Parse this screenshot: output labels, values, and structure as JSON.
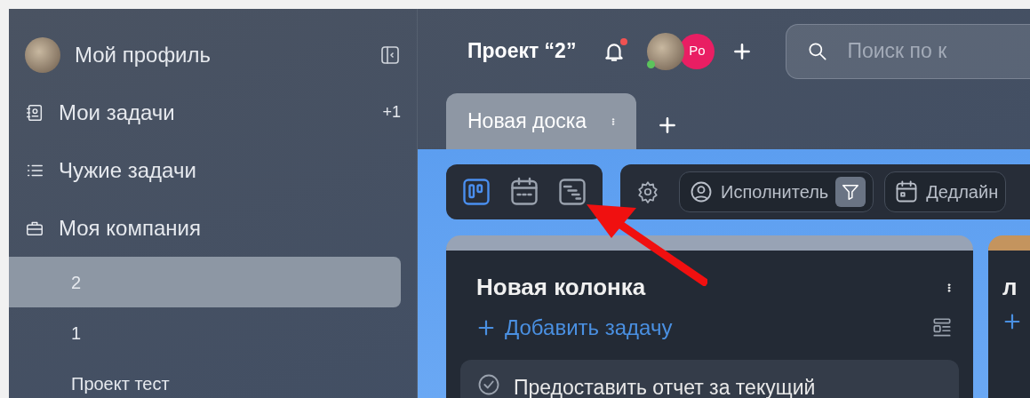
{
  "sidebar": {
    "profile": {
      "name": "Мой профиль"
    },
    "items": [
      {
        "kind": "my-tasks",
        "label": "Мои задачи",
        "badge": "+1"
      },
      {
        "kind": "others-tasks",
        "label": "Чужие задачи"
      },
      {
        "kind": "company",
        "label": "Моя компания"
      }
    ],
    "projects": [
      {
        "label": "2",
        "selected": true
      },
      {
        "label": "1",
        "selected": false
      },
      {
        "label": "Проект тест",
        "selected": false
      }
    ]
  },
  "header": {
    "title": "Проект “2”",
    "notification_dot": true,
    "avatars": [
      {
        "kind": "photo",
        "online": true
      },
      {
        "kind": "initials",
        "initials": "Po",
        "color": "#e91e63"
      }
    ],
    "search": {
      "placeholder": "Поиск по к"
    }
  },
  "tabs": [
    {
      "label": "Новая доска",
      "selected": true
    }
  ],
  "view_modes": [
    {
      "kind": "board",
      "selected": true
    },
    {
      "kind": "calendar",
      "selected": false
    },
    {
      "kind": "gantt",
      "selected": false
    }
  ],
  "filters": [
    {
      "kind": "assignee",
      "label": "Исполнитель",
      "active": true
    },
    {
      "kind": "deadline",
      "label": "Дедлайн",
      "active": false
    }
  ],
  "columns": [
    {
      "title": "Новая колонка",
      "color": "#98a3b5",
      "add_label": "Добавить задачу",
      "cards": [
        {
          "title": "Предоставить отчет за текущий"
        }
      ]
    },
    {
      "title": "л",
      "color": "#c4945e"
    }
  ]
}
